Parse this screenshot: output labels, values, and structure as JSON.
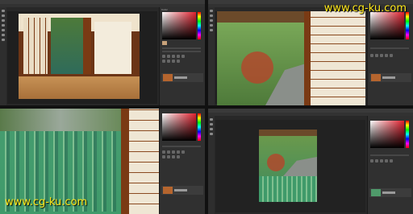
{
  "watermark": {
    "top_right": "www.cg-ku.com",
    "bottom_left": "www.cg-ku.com"
  },
  "panels": {
    "tab_label": "Color",
    "layer_label": "Layer 1"
  },
  "documents": [
    {
      "status": "16.7%"
    },
    {
      "status": "16.7%"
    },
    {
      "status": "16.7%"
    },
    {
      "status": "16.7%"
    }
  ],
  "colors": {
    "ui_dark": "#282828",
    "watermark": "#ffe81a",
    "wood": "#8a3a12"
  }
}
